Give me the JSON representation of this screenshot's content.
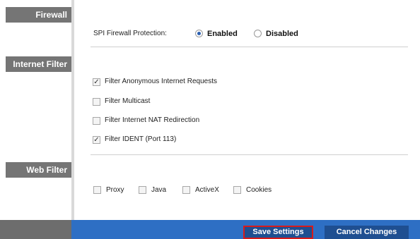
{
  "sections": {
    "firewall": "Firewall",
    "internet_filter": "Internet Filter",
    "web_filter": "Web Filter"
  },
  "firewall": {
    "label": "SPI Firewall Protection:",
    "enabled_label": "Enabled",
    "disabled_label": "Disabled",
    "selected": "Enabled"
  },
  "internet_filter": {
    "items": [
      {
        "label": "Filter Anonymous Internet Requests",
        "checked": true
      },
      {
        "label": "Filter Multicast",
        "checked": false
      },
      {
        "label": "Filter Internet NAT Redirection",
        "checked": false
      },
      {
        "label": "Filter IDENT (Port 113)",
        "checked": true
      }
    ]
  },
  "web_filter": {
    "items": [
      {
        "label": "Proxy",
        "checked": false
      },
      {
        "label": "Java",
        "checked": false
      },
      {
        "label": "ActiveX",
        "checked": false
      },
      {
        "label": "Cookies",
        "checked": false
      }
    ]
  },
  "footer": {
    "save_label": "Save Settings",
    "cancel_label": "Cancel Changes"
  },
  "colors": {
    "section_bg": "#757575",
    "footer_bg": "#2e6fc4",
    "button_bg": "#1f4f91",
    "highlight": "#d81b1b"
  }
}
